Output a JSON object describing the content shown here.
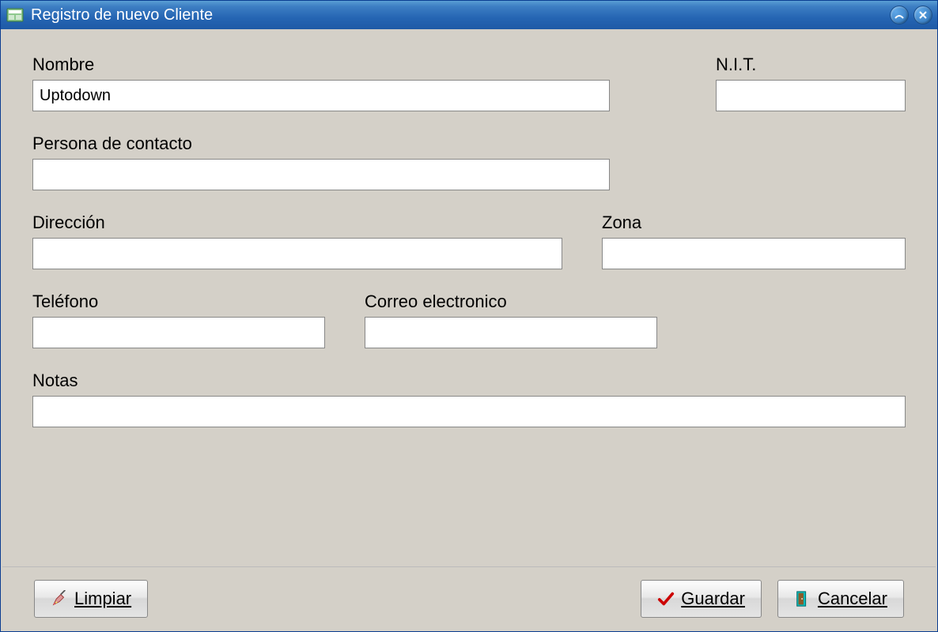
{
  "window": {
    "title": "Registro de nuevo Cliente"
  },
  "fields": {
    "nombre": {
      "label": "Nombre",
      "value": "Uptodown"
    },
    "nit": {
      "label": "N.I.T.",
      "value": ""
    },
    "contacto": {
      "label": "Persona de contacto",
      "value": ""
    },
    "direccion": {
      "label": "Dirección",
      "value": ""
    },
    "zona": {
      "label": "Zona",
      "value": ""
    },
    "telefono": {
      "label": "Teléfono",
      "value": ""
    },
    "correo": {
      "label": "Correo electronico",
      "value": ""
    },
    "notas": {
      "label": "Notas",
      "value": ""
    }
  },
  "buttons": {
    "limpiar": "Limpiar",
    "guardar": "Guardar",
    "cancelar": "Cancelar"
  }
}
